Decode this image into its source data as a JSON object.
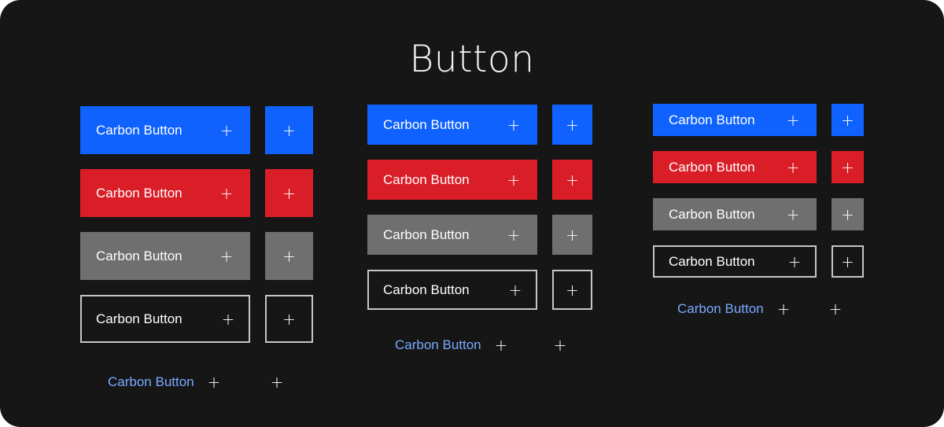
{
  "title": "Button",
  "button_label": "Carbon Button",
  "icon_symbol": "+",
  "icon_name": "add-icon",
  "colors": {
    "background": "#161616",
    "primary": "#0f62fe",
    "danger": "#da1e28",
    "secondary": "#6f6f6f",
    "tertiary_border": "#c6c6c6",
    "ghost_text": "#78a9ff"
  },
  "sizes": [
    "large",
    "medium",
    "small"
  ],
  "variants": [
    "primary",
    "danger",
    "secondary",
    "tertiary",
    "ghost"
  ]
}
